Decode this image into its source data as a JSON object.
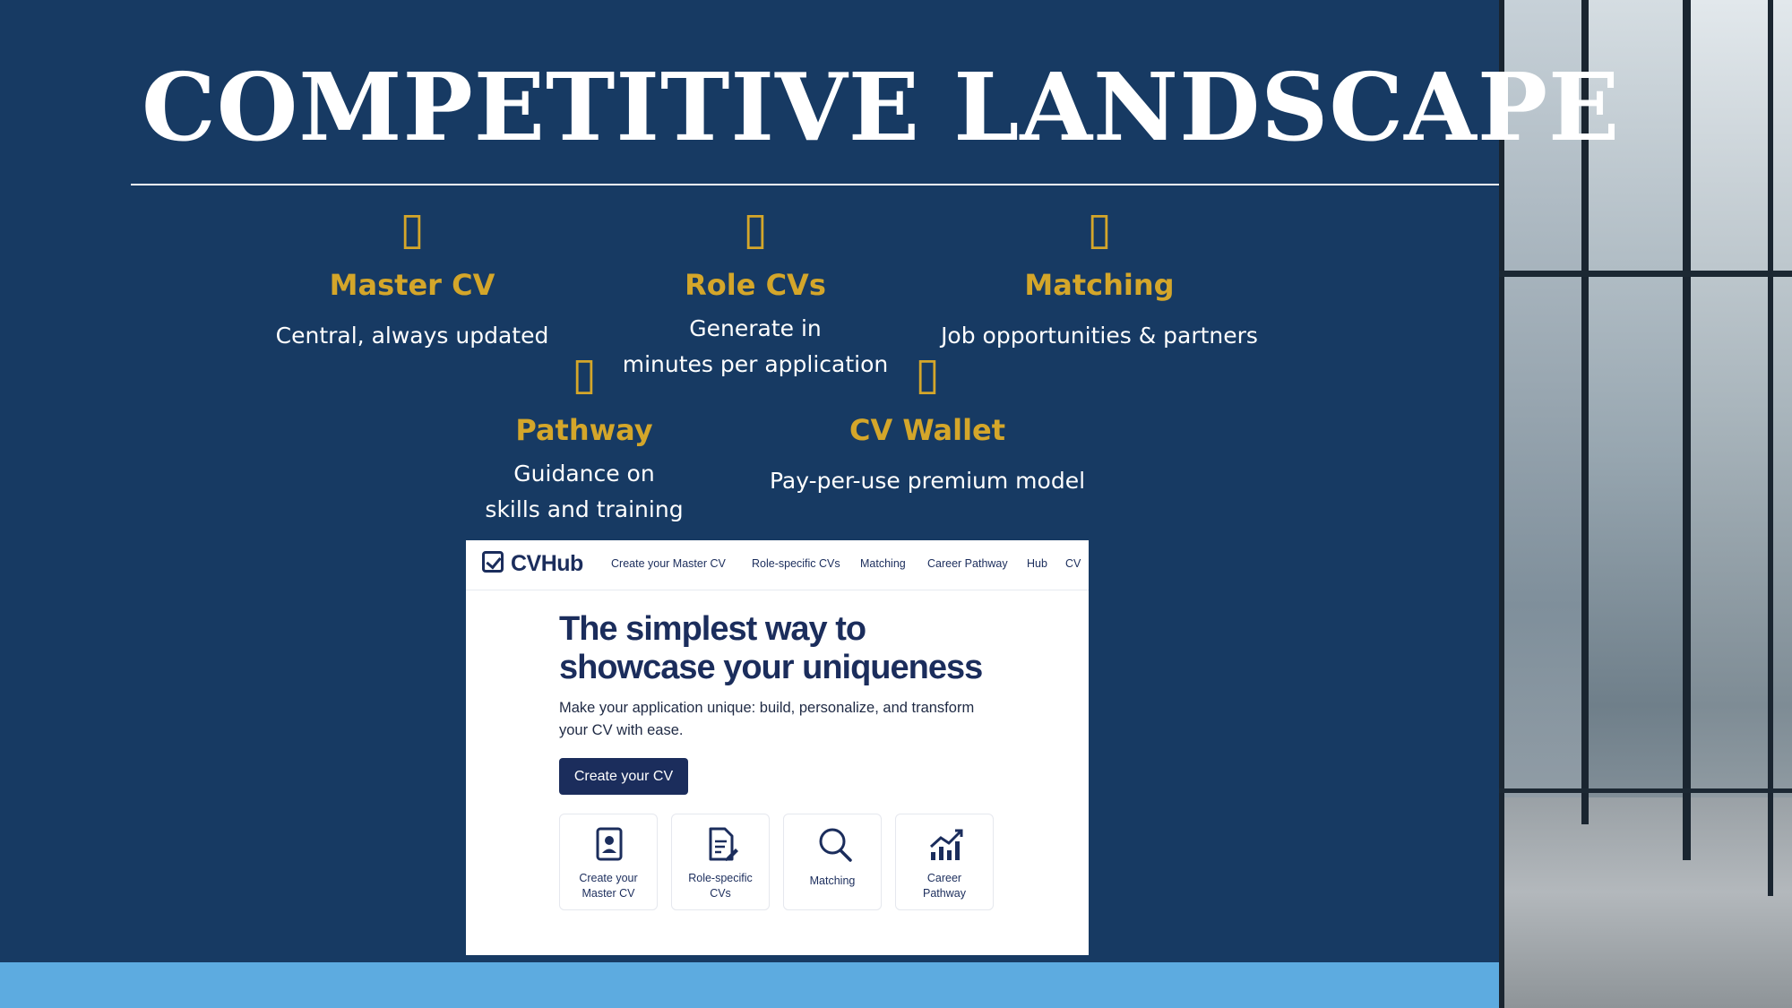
{
  "slide": {
    "title": "COMPETITIVE LANDSCAPE",
    "colors": {
      "background": "#173a63",
      "accent": "#d4a62a",
      "band": "#5dabe0",
      "text": "#ffffff"
    }
  },
  "features": [
    {
      "icon": "missing-glyph-icon",
      "glyph": "▯",
      "title": "Master CV",
      "desc": [
        "Central, always updated"
      ]
    },
    {
      "icon": "missing-glyph-icon",
      "glyph": "▯",
      "title": "Role CVs",
      "desc": [
        "Generate in",
        "minutes per application"
      ]
    },
    {
      "icon": "missing-glyph-icon",
      "glyph": "▯",
      "title": "Matching",
      "desc": [
        "Job opportunities & partners"
      ]
    },
    {
      "icon": "missing-glyph-icon",
      "glyph": "▯",
      "title": "Pathway",
      "desc": [
        "Guidance on",
        "skills and training"
      ]
    },
    {
      "icon": "missing-glyph-icon",
      "glyph": "▯",
      "title": "CV Wallet",
      "desc": [
        "Pay-per-use premium model"
      ]
    }
  ],
  "screenshot": {
    "logo": "CVHub",
    "nav": [
      "Create your Master CV",
      "Role-specific CVs",
      "Matching",
      "Career Pathway",
      "Hub",
      "CV"
    ],
    "hero": [
      "The simplest way to",
      "showcase your uniqueness"
    ],
    "subtitle": [
      "Make your application unique: build, personalize, and transform",
      "your CV with ease."
    ],
    "cta": "Create your CV",
    "cards": [
      {
        "icon": "id-card-icon",
        "label": [
          "Create your",
          "Master CV"
        ]
      },
      {
        "icon": "document-edit-icon",
        "label": [
          "Role-specific",
          "CVs"
        ]
      },
      {
        "icon": "search-icon",
        "label": [
          "Matching"
        ]
      },
      {
        "icon": "growth-chart-icon",
        "label": [
          "Career",
          "Pathway"
        ]
      }
    ]
  }
}
